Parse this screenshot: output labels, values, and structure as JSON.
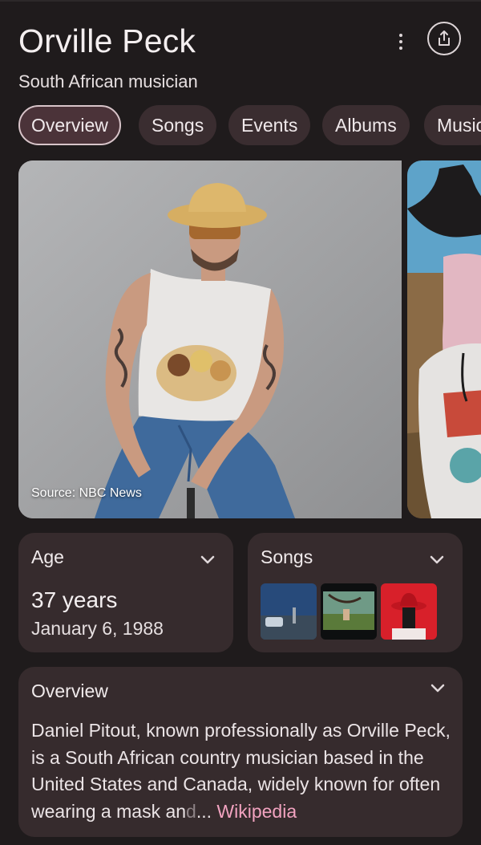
{
  "header": {
    "title": "Orville Peck",
    "subtitle": "South African musician"
  },
  "tabs": [
    {
      "label": "Overview",
      "active": true
    },
    {
      "label": "Songs",
      "active": false
    },
    {
      "label": "Events",
      "active": false
    },
    {
      "label": "Albums",
      "active": false
    },
    {
      "label": "Music",
      "active": false
    }
  ],
  "images": {
    "source_caption": "Source: NBC News"
  },
  "age_card": {
    "label": "Age",
    "value": "37 years",
    "date": "January 6, 1988"
  },
  "songs_card": {
    "label": "Songs"
  },
  "overview_card": {
    "label": "Overview",
    "text": "Daniel Pitout, known professionally as Orville Peck, is a South African country musician based in the United States and Canada, widely known for often wearing a mask an",
    "faded": "d",
    "ellipsis": "...",
    "link": "Wikipedia"
  },
  "icons": {
    "menu": "more-vert-icon",
    "share": "share-icon",
    "expand": "chevron-down-icon"
  },
  "colors": {
    "background": "#1f1b1c",
    "card": "#362b2d",
    "chip": "#3a2d30",
    "chip_active": "#4b3339",
    "link": "#f2a3c0"
  }
}
